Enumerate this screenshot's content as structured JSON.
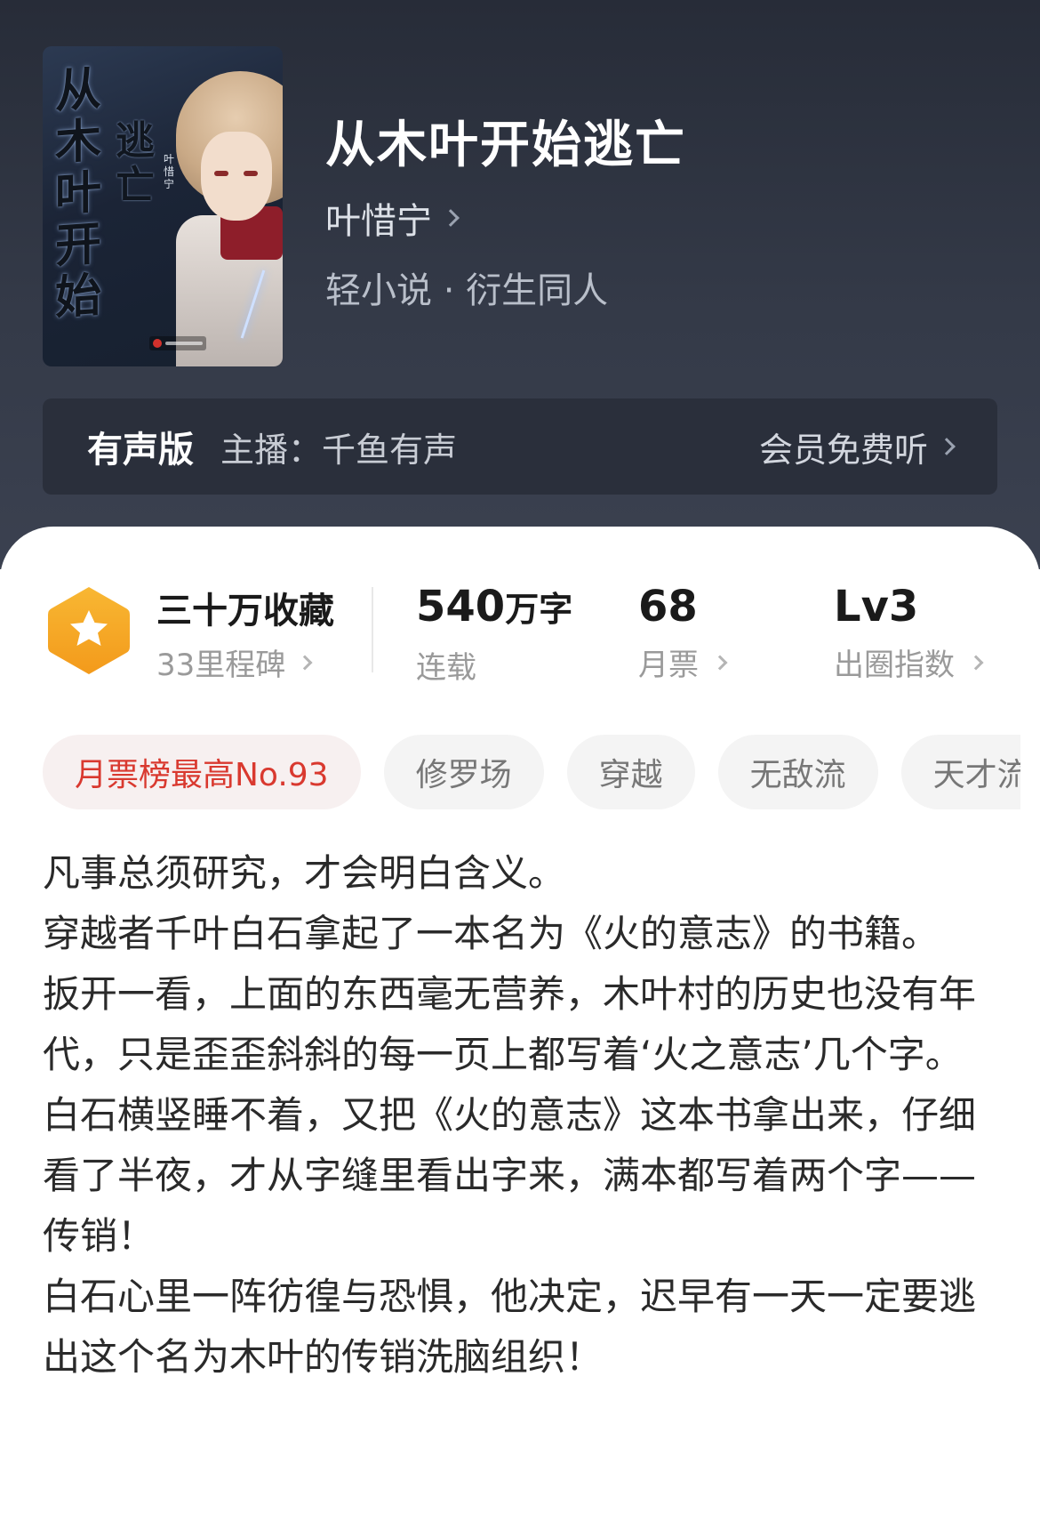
{
  "book": {
    "title": "从木叶开始逃亡",
    "author": "叶惜宁",
    "category": "轻小说 · 衍生同人",
    "cover": {
      "title_glyphs": [
        "从",
        "木",
        "叶",
        "开",
        "始"
      ],
      "title_glyphs2": [
        "逃",
        "亡"
      ],
      "author_vertical": "叶惜宁"
    }
  },
  "audio": {
    "label": "有声版",
    "host": "主播：千鱼有声",
    "cta": "会员免费听"
  },
  "stats": {
    "favorites_title": "三十万收藏",
    "milestones": "33里程碑",
    "words_number": "540",
    "words_unit": "万字",
    "words_label": "连载",
    "monthly_votes": "68",
    "monthly_votes_label": "月票",
    "level": "Lv3",
    "level_label": "出圈指数"
  },
  "tags": [
    "月票榜最高No.93",
    "修罗场",
    "穿越",
    "无敌流",
    "天才流"
  ],
  "synopsis": [
    "凡事总须研究，才会明白含义。",
    "穿越者千叶白石拿起了一本名为《火的意志》的书籍。",
    "扳开一看，上面的东西毫无营养，木叶村的历史也没有年代，只是歪歪斜斜的每一页上都写着‘火之意志’几个字。",
    "白石横竖睡不着，又把《火的意志》这本书拿出来，仔细看了半夜，才从字缝里看出字来，满本都写着两个字——传销！",
    "白石心里一阵彷徨与恐惧，他决定，迟早有一天一定要逃出这个名为木叶的传销洗脑组织！"
  ],
  "colors": {
    "header_bg": "#2e3340",
    "badge_orange": "#f5a623",
    "tag_hot": "#d9392f"
  }
}
